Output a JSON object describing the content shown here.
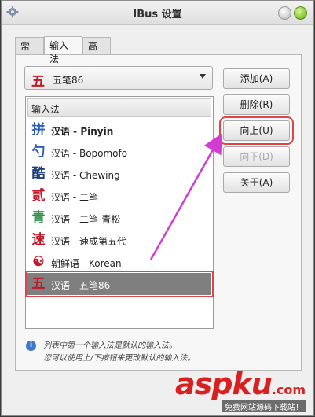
{
  "window": {
    "title": "IBus 设置"
  },
  "tabs": [
    {
      "label": "常规",
      "active": false
    },
    {
      "label": "输入法",
      "active": true
    },
    {
      "label": "高级",
      "active": false
    }
  ],
  "combo": {
    "glyph": "五",
    "value": "五笔86",
    "glyph_color": "#c0182a"
  },
  "list": {
    "header": "输入法",
    "items": [
      {
        "glyph": "拼",
        "label": "汉语 - Pinyin",
        "glyph_color": "#2f5fb5",
        "bold": true
      },
      {
        "glyph": "勺",
        "label": "汉语 - Bopomofo",
        "glyph_color": "#2f5fb5"
      },
      {
        "glyph": "酷",
        "label": "汉语 - Chewing",
        "glyph_color": "#1f3f7a"
      },
      {
        "glyph": "贰",
        "label": "汉语 - 二笔",
        "glyph_color": "#c0182a"
      },
      {
        "glyph": "青",
        "label": "汉语 - 二笔-青松",
        "glyph_color": "#2f8f4a"
      },
      {
        "glyph": "速",
        "label": "汉语 - 速成第五代",
        "glyph_color": "#c0182a"
      },
      {
        "glyph": "☯",
        "label": "朝鲜语 - Korean",
        "glyph_color": "#c0182a"
      },
      {
        "glyph": "五",
        "label": "汉语 - 五笔86",
        "glyph_color": "#c0182a",
        "selected": true
      }
    ]
  },
  "buttons": {
    "add": "添加(A)",
    "remove": "删除(R)",
    "up": "向上(U)",
    "down": "向下(D)",
    "about": "关于(A)"
  },
  "info": {
    "line1": "列表中第一个输入法是默认的输入法。",
    "line2": "您可以使用上/下按钮来更改默认的输入法。"
  },
  "watermark": {
    "brand": "aspku",
    "tld": ".com",
    "sub": "免费网站源码下载站！"
  },
  "colors": {
    "highlight": "#d84848",
    "arrow": "#d23cd2",
    "selection": "#7f7f7f"
  }
}
